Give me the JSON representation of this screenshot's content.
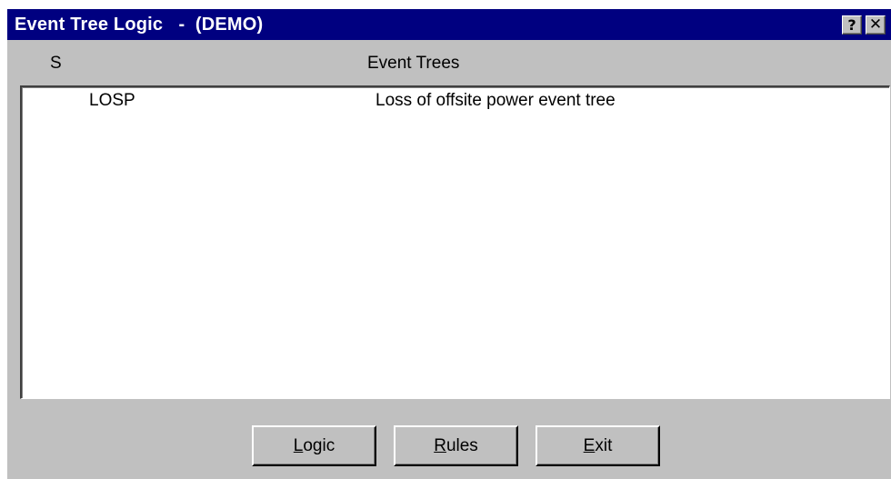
{
  "window": {
    "title": "Event Tree Logic   -  (DEMO)",
    "help_label": "?",
    "close_label": "✕"
  },
  "columns": {
    "status_header": "S",
    "event_trees_header": "Event Trees"
  },
  "event_trees": [
    {
      "name": "LOSP",
      "description": "Loss of offsite power event tree"
    }
  ],
  "buttons": {
    "logic": {
      "mnemonic": "L",
      "rest": "ogic"
    },
    "rules": {
      "mnemonic": "R",
      "rest": "ules"
    },
    "exit": {
      "mnemonic": "E",
      "rest": "xit"
    }
  },
  "colors": {
    "titlebar": "#000080",
    "face": "#c0c0c0"
  }
}
